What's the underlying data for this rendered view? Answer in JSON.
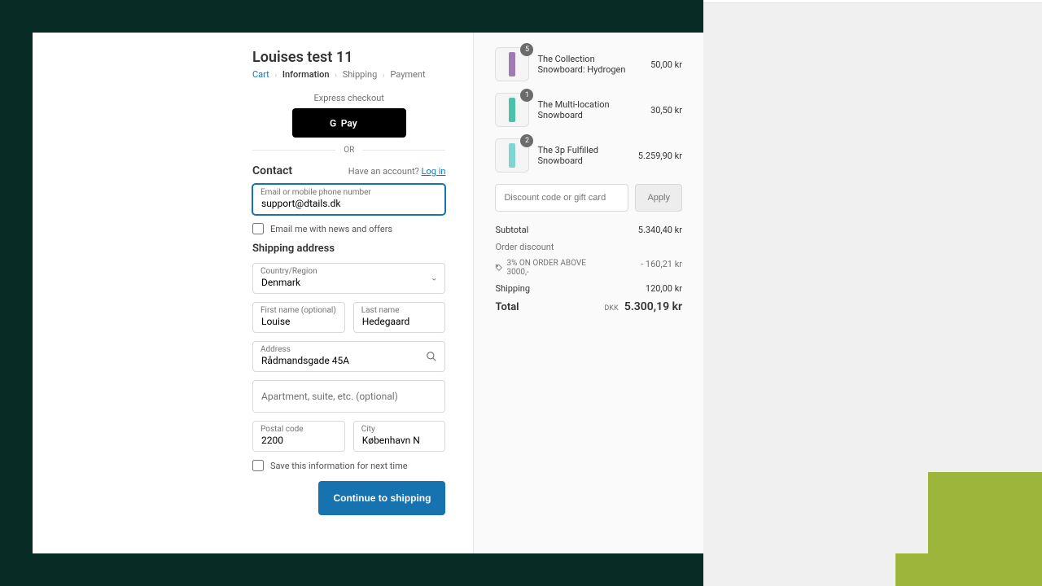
{
  "store_title": "Louises test 11",
  "breadcrumbs": {
    "cart": "Cart",
    "information": "Information",
    "shipping": "Shipping",
    "payment": "Payment"
  },
  "express": {
    "label": "Express checkout",
    "provider": "G Pay",
    "or": "OR"
  },
  "contact": {
    "heading": "Contact",
    "have_account": "Have an account?",
    "login": "Log in",
    "email_label": "Email or mobile phone number",
    "email_value": "support@dtails.dk",
    "news_opt": "Email me with news and offers"
  },
  "shipping": {
    "heading": "Shipping address",
    "country_label": "Country/Region",
    "country_value": "Denmark",
    "first_label": "First name (optional)",
    "first_value": "Louise",
    "last_label": "Last name",
    "last_value": "Hedegaard",
    "address_label": "Address",
    "address_value": "Rådmandsgade 45A",
    "apt_placeholder": "Apartment, suite, etc. (optional)",
    "zip_label": "Postal code",
    "zip_value": "2200",
    "city_label": "City",
    "city_value": "København N",
    "save_info": "Save this information for next time"
  },
  "actions": {
    "continue": "Continue to shipping"
  },
  "cart": {
    "items": [
      {
        "qty": "5",
        "name": "The Collection Snowboard: Hydrogen",
        "price": "50,00 kr",
        "color": "#a07ab5"
      },
      {
        "qty": "1",
        "name": "The Multi-location Snowboard",
        "price": "30,50 kr",
        "color": "#4bc3a8"
      },
      {
        "qty": "2",
        "name": "The 3p Fulfilled Snowboard",
        "price": "5.259,90 kr",
        "color": "#7fd6d0"
      }
    ],
    "discount_placeholder": "Discount code or gift card",
    "apply": "Apply",
    "subtotal_label": "Subtotal",
    "subtotal_value": "5.340,40 kr",
    "orderdisc_label": "Order discount",
    "disc_tag": "3% ON ORDER ABOVE 3000,-",
    "disc_value": "- 160,21 kr",
    "shipping_label": "Shipping",
    "shipping_value": "120,00 kr",
    "total_label": "Total",
    "currency": "DKK",
    "total_value": "5.300,19 kr"
  }
}
